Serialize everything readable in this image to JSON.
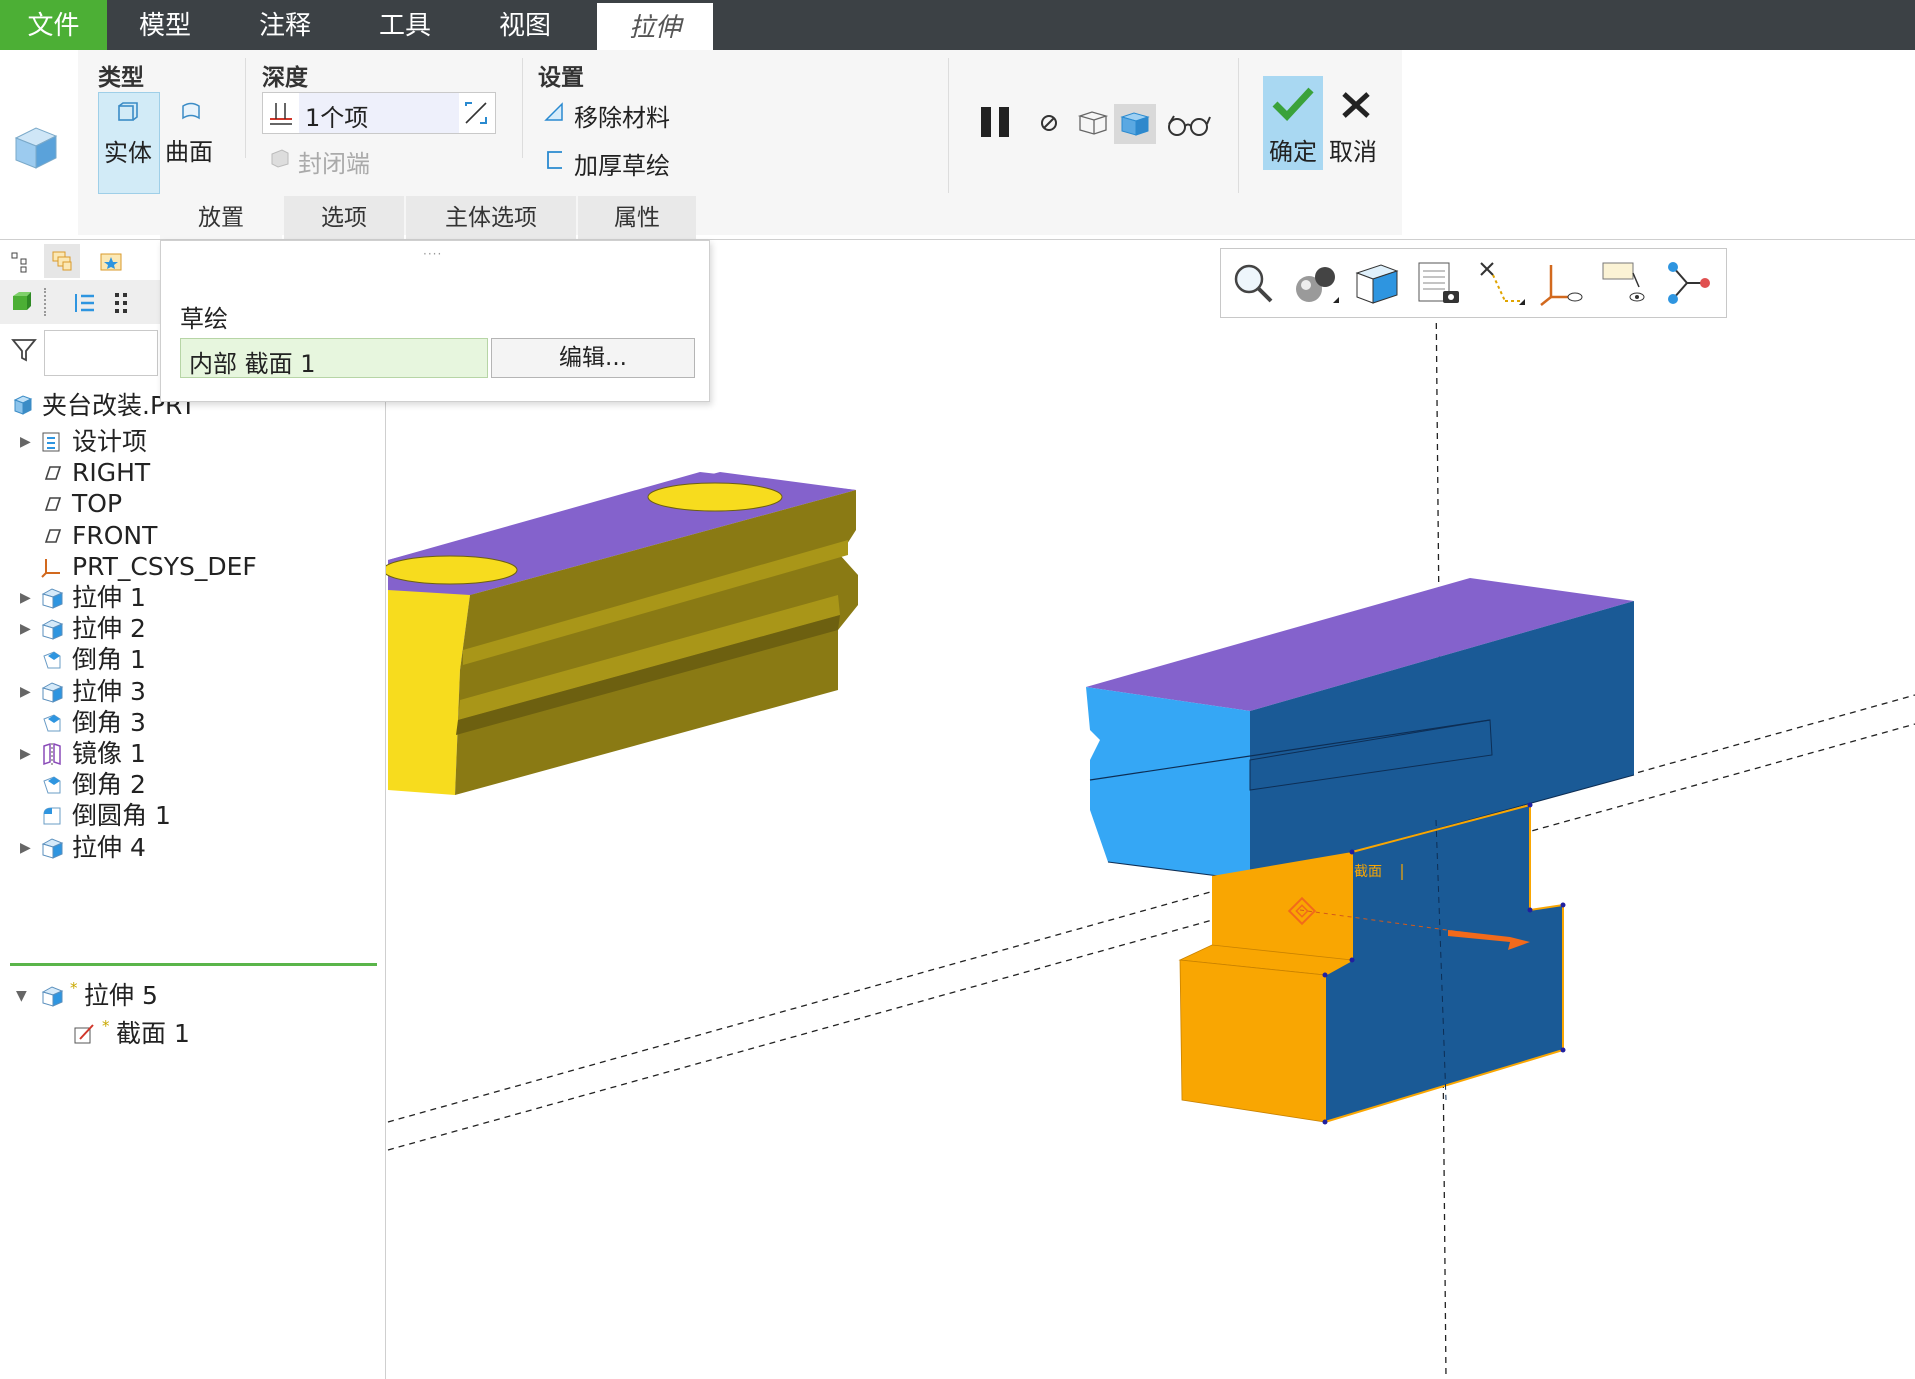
{
  "menu": {
    "items": [
      "文件",
      "模型",
      "注释",
      "工具",
      "视图",
      "拉伸"
    ]
  },
  "ribbon": {
    "type": {
      "title": "类型",
      "solid": "实体",
      "surface": "曲面"
    },
    "depth": {
      "title": "深度",
      "value": "1个项",
      "cap_ends": "封闭端"
    },
    "settings": {
      "title": "设置",
      "remove_material": "移除材料",
      "thicken_sketch": "加厚草绘"
    },
    "confirm": "确定",
    "cancel": "取消",
    "tabs": [
      "放置",
      "选项",
      "主体选项",
      "属性"
    ]
  },
  "placement_panel": {
    "sketch_label": "草绘",
    "section_value": "内部 截面 1",
    "edit_button": "编辑..."
  },
  "tree": {
    "root": "夹台改装.PRT",
    "items": [
      {
        "label": "设计项",
        "icon": "design-items-icon",
        "expandable": true
      },
      {
        "label": "RIGHT",
        "icon": "datum-plane-icon",
        "expandable": false
      },
      {
        "label": "TOP",
        "icon": "datum-plane-icon",
        "expandable": false
      },
      {
        "label": "FRONT",
        "icon": "datum-plane-icon",
        "expandable": false
      },
      {
        "label": "PRT_CSYS_DEF",
        "icon": "csys-icon",
        "expandable": false
      },
      {
        "label": "拉伸 1",
        "icon": "extrude-icon",
        "expandable": true
      },
      {
        "label": "拉伸 2",
        "icon": "extrude-icon",
        "expandable": true
      },
      {
        "label": "倒角 1",
        "icon": "chamfer-icon",
        "expandable": false
      },
      {
        "label": "拉伸 3",
        "icon": "extrude-icon",
        "expandable": true
      },
      {
        "label": "倒角 3",
        "icon": "chamfer-icon",
        "expandable": false
      },
      {
        "label": "镜像 1",
        "icon": "mirror-icon",
        "expandable": true
      },
      {
        "label": "倒角 2",
        "icon": "chamfer-icon",
        "expandable": false
      },
      {
        "label": "倒圆角 1",
        "icon": "round-icon",
        "expandable": false
      },
      {
        "label": "拉伸 4",
        "icon": "extrude-icon",
        "expandable": true
      }
    ],
    "active_feature": "拉伸 5",
    "active_child": "截面 1",
    "new_marker": "*"
  },
  "viewport": {
    "section_tag": "截面",
    "colors": {
      "top_face": "#8462cc",
      "yellow": "#f7dc1e",
      "olive": "#8a7a14",
      "light_blue": "#35a7f5",
      "dark_blue": "#1a5a96",
      "orange": "#f9a602",
      "accent_arrow": "#f26a1b"
    }
  },
  "colors": {
    "menubar": "#3c4145",
    "file_tab": "#4caf35",
    "accent": "#5ab54a",
    "selected": "#d2ebf7"
  }
}
